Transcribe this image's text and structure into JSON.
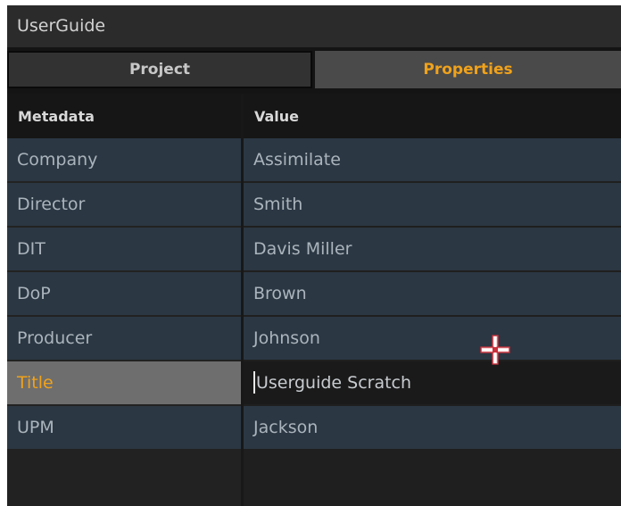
{
  "window": {
    "title": "UserGuide"
  },
  "tabs": [
    {
      "label": "Project",
      "active": false
    },
    {
      "label": "Properties",
      "active": true
    }
  ],
  "table": {
    "headers": {
      "key": "Metadata",
      "value": "Value"
    },
    "rows": [
      {
        "key": "Company",
        "value": "Assimilate"
      },
      {
        "key": "Director",
        "value": "Smith"
      },
      {
        "key": "DIT",
        "value": "Davis Miller"
      },
      {
        "key": "DoP",
        "value": "Brown"
      },
      {
        "key": "Producer",
        "value": "Johnson"
      },
      {
        "key": "Title",
        "value": "Userguide Scratch",
        "selected": true,
        "editing": true
      },
      {
        "key": "UPM",
        "value": "Jackson"
      }
    ]
  },
  "colors": {
    "accent": "#f0a21b",
    "row_background": "#2b3743",
    "selected_key_background": "#6e6e6e",
    "panel_background": "#1e1e1e"
  },
  "icons": {
    "pointer": "crosshair-cursor-icon"
  }
}
